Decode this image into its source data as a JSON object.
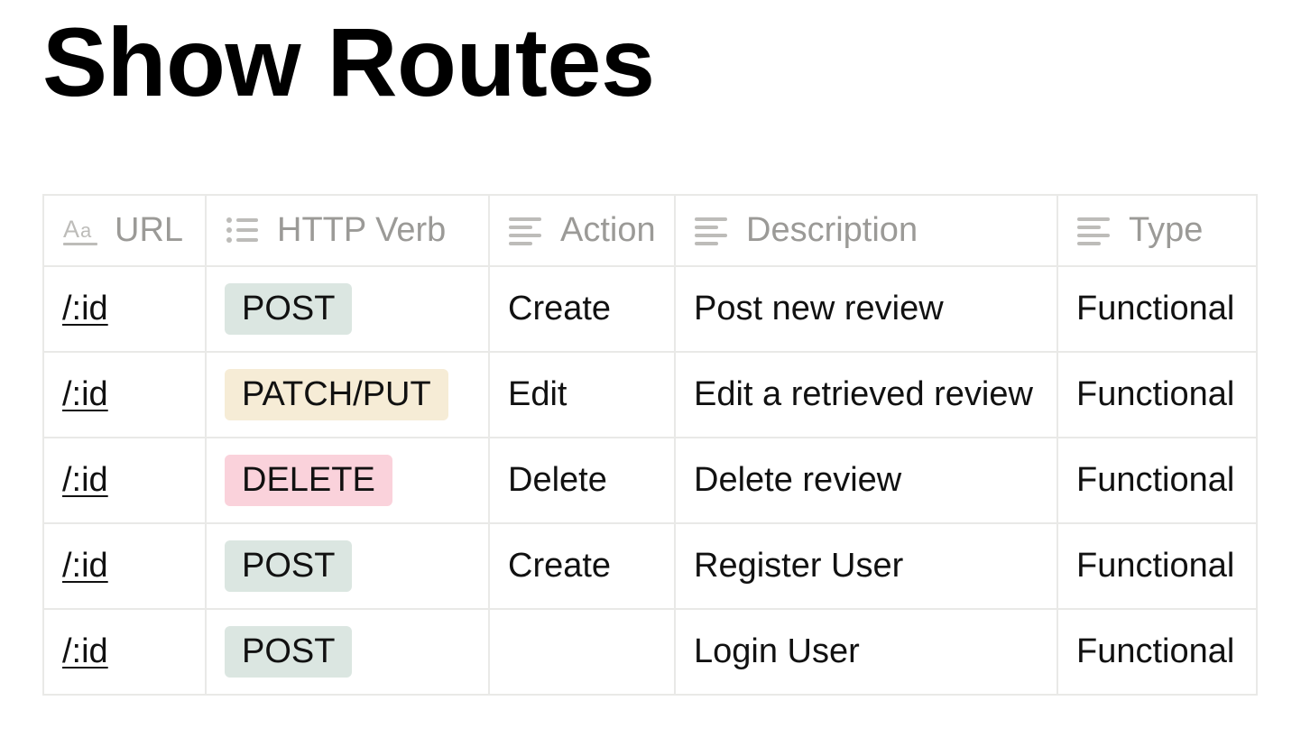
{
  "page": {
    "title": "Show Routes"
  },
  "table": {
    "columns": [
      {
        "label": "URL",
        "icon": "text-property-icon"
      },
      {
        "label": "HTTP Verb",
        "icon": "multi-select-icon"
      },
      {
        "label": "Action",
        "icon": "text-lines-icon"
      },
      {
        "label": "Description",
        "icon": "text-lines-icon"
      },
      {
        "label": "Type",
        "icon": "text-lines-icon"
      }
    ],
    "rows": [
      {
        "url": "/:id",
        "verb": "POST",
        "action": "Create",
        "description": "Post new review",
        "type": "Functional"
      },
      {
        "url": "/:id",
        "verb": "PATCH/PUT",
        "action": "Edit",
        "description": "Edit a retrieved review",
        "type": "Functional"
      },
      {
        "url": "/:id",
        "verb": "DELETE",
        "action": "Delete",
        "description": "Delete review",
        "type": "Functional"
      },
      {
        "url": "/:id",
        "verb": "POST",
        "action": "Create",
        "description": "Register User",
        "type": "Functional"
      },
      {
        "url": "/:id",
        "verb": "POST",
        "action": "",
        "description": "Login User",
        "type": "Functional"
      }
    ]
  },
  "colors": {
    "header_text": "#9b9a97",
    "border": "#e9e9e7",
    "tag_post": "#dbe6e1",
    "tag_patch_put": "#f6ecd6",
    "tag_delete": "#fad2db"
  }
}
